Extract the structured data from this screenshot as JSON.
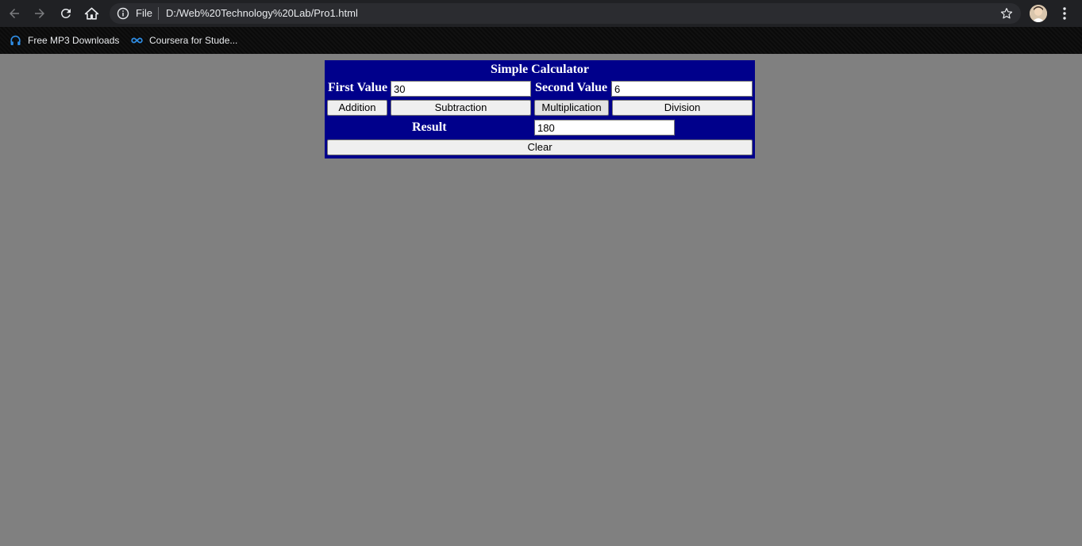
{
  "browser": {
    "address": {
      "scheme_label": "File",
      "url": "D:/Web%20Technology%20Lab/Pro1.html"
    },
    "bookmarks": [
      {
        "label": "Free MP3 Downloads",
        "icon": "headphones-icon"
      },
      {
        "label": "Coursera for Stude...",
        "icon": "coursera-infinity-icon"
      }
    ],
    "icons": [
      "back-arrow-icon",
      "forward-arrow-icon",
      "reload-icon",
      "home-icon",
      "info-icon",
      "star-icon",
      "avatar",
      "more-vert-icon"
    ]
  },
  "calculator": {
    "title": "Simple Calculator",
    "first_label": "First Value",
    "first_value": "30",
    "second_label": "Second Value",
    "second_value": "6",
    "buttons": {
      "addition": "Addition",
      "subtraction": "Subtraction",
      "multiplication": "Multiplication",
      "division": "Division",
      "clear": "Clear"
    },
    "result_label": "Result",
    "result_value": "180"
  },
  "colors": {
    "page_background": "#808080",
    "calculator_background": "#00008b",
    "browser_toolbar": "#202124"
  }
}
